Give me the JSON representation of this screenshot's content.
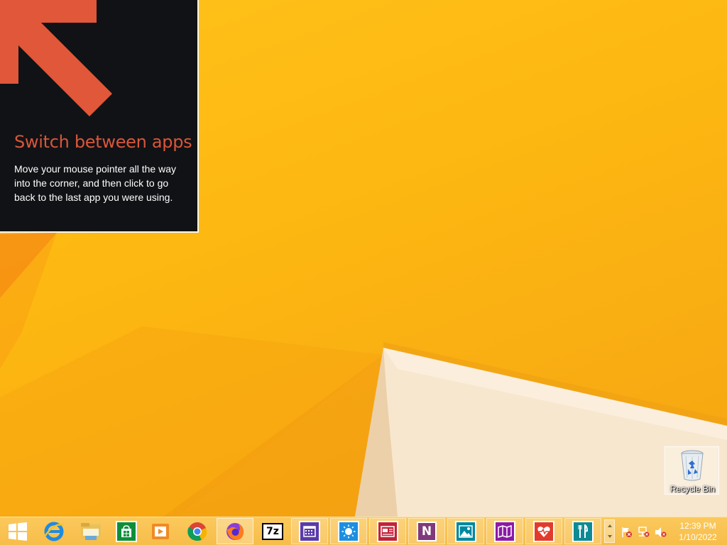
{
  "tip": {
    "title": "Switch between apps",
    "body": "Move your mouse pointer all the way into the corner, and then click to go back to the last app you were using."
  },
  "desktop": {
    "recycle_bin_label": "Recycle Bin"
  },
  "taskbar": {
    "start_icon": "windows-logo-icon",
    "apps": [
      {
        "icon": "internet-explorer-icon"
      },
      {
        "icon": "file-explorer-icon"
      },
      {
        "icon": "windows-store-icon"
      },
      {
        "icon": "video-app-icon"
      },
      {
        "icon": "chrome-icon"
      },
      {
        "icon": "firefox-icon"
      },
      {
        "icon": "7zip-icon",
        "label": "7z"
      },
      {
        "icon": "calendar-app-icon"
      },
      {
        "icon": "weather-app-icon"
      },
      {
        "icon": "news-app-icon"
      },
      {
        "icon": "onenote-icon",
        "label": "N"
      },
      {
        "icon": "photos-app-icon"
      },
      {
        "icon": "maps-app-icon"
      },
      {
        "icon": "health-app-icon"
      },
      {
        "icon": "food-app-icon"
      }
    ],
    "tray": {
      "icons": [
        "action-center-flag-icon",
        "network-icon",
        "volume-muted-icon"
      ],
      "time": "12:39 PM",
      "date": "1/10/2022"
    }
  },
  "colors": {
    "wallpaper": "#fbb614",
    "tip_bg": "#111215",
    "tip_accent": "#d8563a",
    "taskbar": "#f7bd49"
  }
}
